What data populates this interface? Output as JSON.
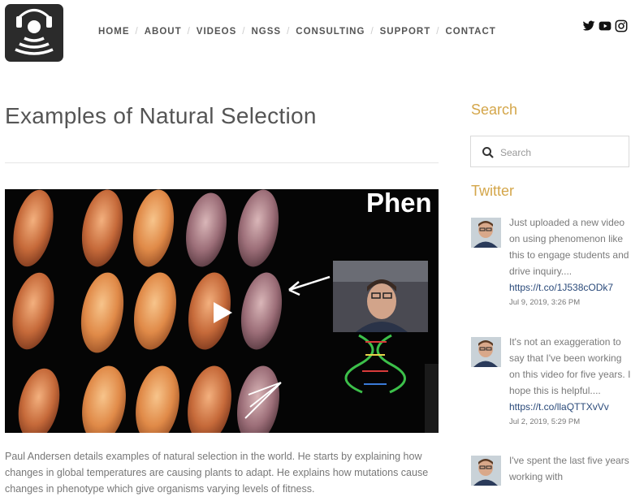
{
  "nav": {
    "items": [
      "HOME",
      "ABOUT",
      "VIDEOS",
      "NGSS",
      "CONSULTING",
      "SUPPORT",
      "CONTACT"
    ]
  },
  "social": [
    "twitter-icon",
    "youtube-icon",
    "instagram-icon"
  ],
  "page": {
    "title": "Examples of Natural Selection"
  },
  "video": {
    "overlay_text": "Phen"
  },
  "description": "Paul Andersen details examples of natural selection in the world. He starts by explaining how changes in global temperatures are causing plants to adapt. He explains how mutations cause changes in phenotype which give organisms varying levels of fitness.",
  "sidebar": {
    "search_heading": "Search",
    "search_placeholder": "Search",
    "twitter_heading": "Twitter",
    "tweets": [
      {
        "text": "Just uploaded a new video on using phenomenon like this to engage students and drive inquiry....",
        "link": "https://t.co/1J538cODk7",
        "time": "Jul 9, 2019, 3:26 PM"
      },
      {
        "text": "It's not an exaggeration to say that I've been working on this video for five years. I hope this is helpful....",
        "link": "https://t.co/llaQTTXvVv",
        "time": "Jul 2, 2019, 5:29 PM"
      },
      {
        "text": "I've spent the last five years working with",
        "link": "",
        "time": ""
      }
    ]
  },
  "colors": {
    "accent": "#d4a64a",
    "link": "#2a4a7a",
    "logo_bg": "#2b2b2b"
  }
}
